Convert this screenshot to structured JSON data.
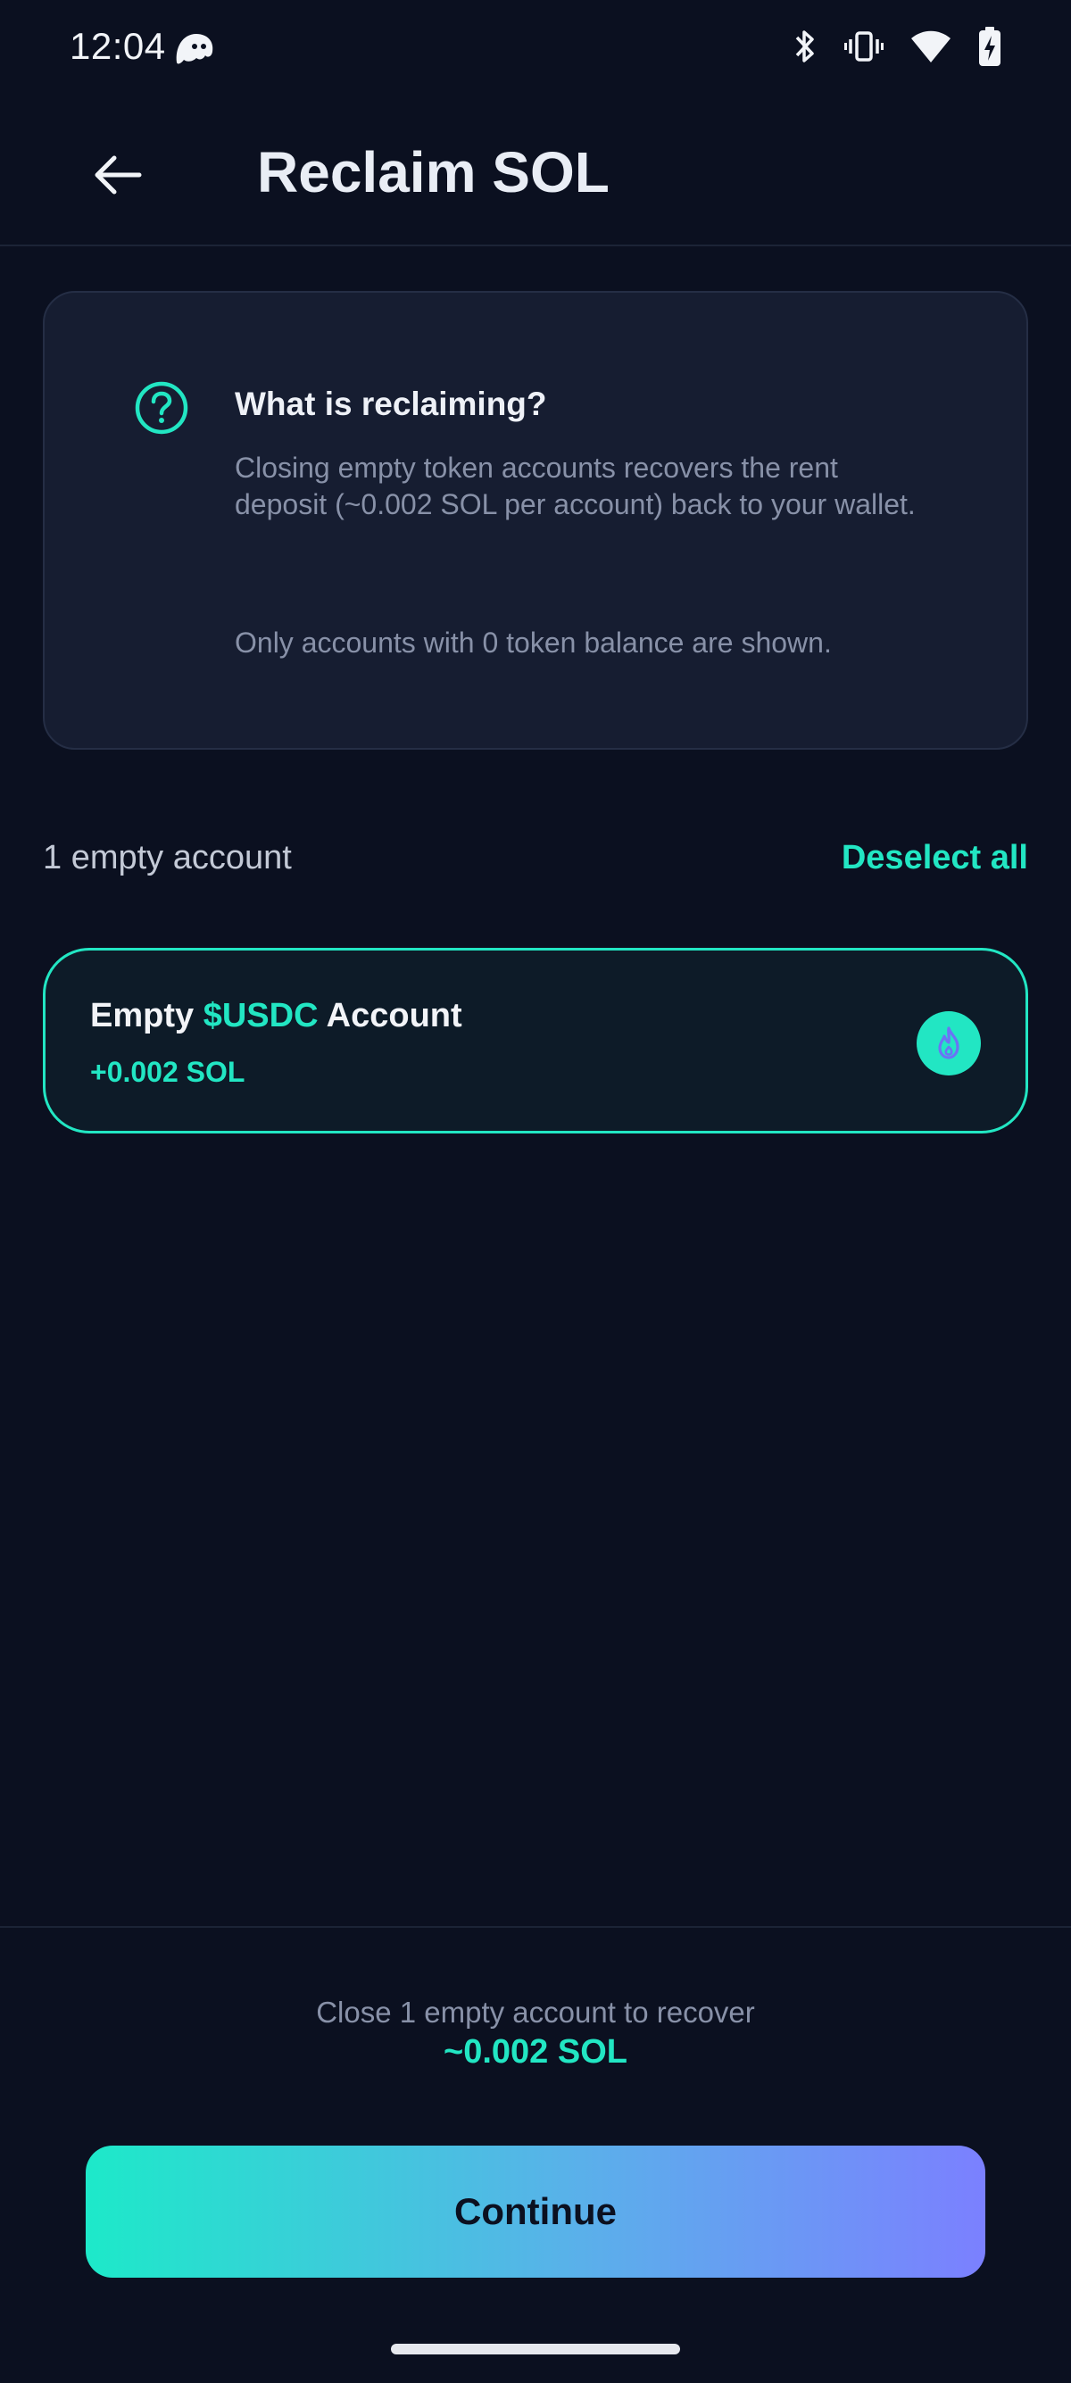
{
  "status_bar": {
    "time": "12:04",
    "icons": [
      "ghost-icon",
      "bluetooth-icon",
      "vibrate-icon",
      "wifi-icon",
      "battery-charging-icon"
    ]
  },
  "header": {
    "title": "Reclaim SOL",
    "back_icon": "arrow-left-icon"
  },
  "info_card": {
    "icon": "question-circle-icon",
    "title": "What is reclaiming?",
    "body": "Closing empty token accounts recovers the rent deposit (~0.002 SOL per account) back to your wallet.",
    "note": "Only accounts with 0 token balance are shown."
  },
  "list": {
    "count_label": "1 empty account",
    "deselect_label": "Deselect all",
    "accounts": [
      {
        "prefix": "Empty ",
        "token": "$USDC",
        "suffix": " Account",
        "amount": "+0.002 SOL",
        "selected": true,
        "icon": "flame-icon"
      }
    ]
  },
  "footer": {
    "summary": "Close 1 empty account to recover",
    "amount": "~0.002 SOL",
    "button_label": "Continue"
  },
  "colors": {
    "background": "#0b1020",
    "accent": "#22e6c3",
    "card": "#161d31",
    "gradient_start": "#1de9c9",
    "gradient_end": "#7b80ff"
  }
}
